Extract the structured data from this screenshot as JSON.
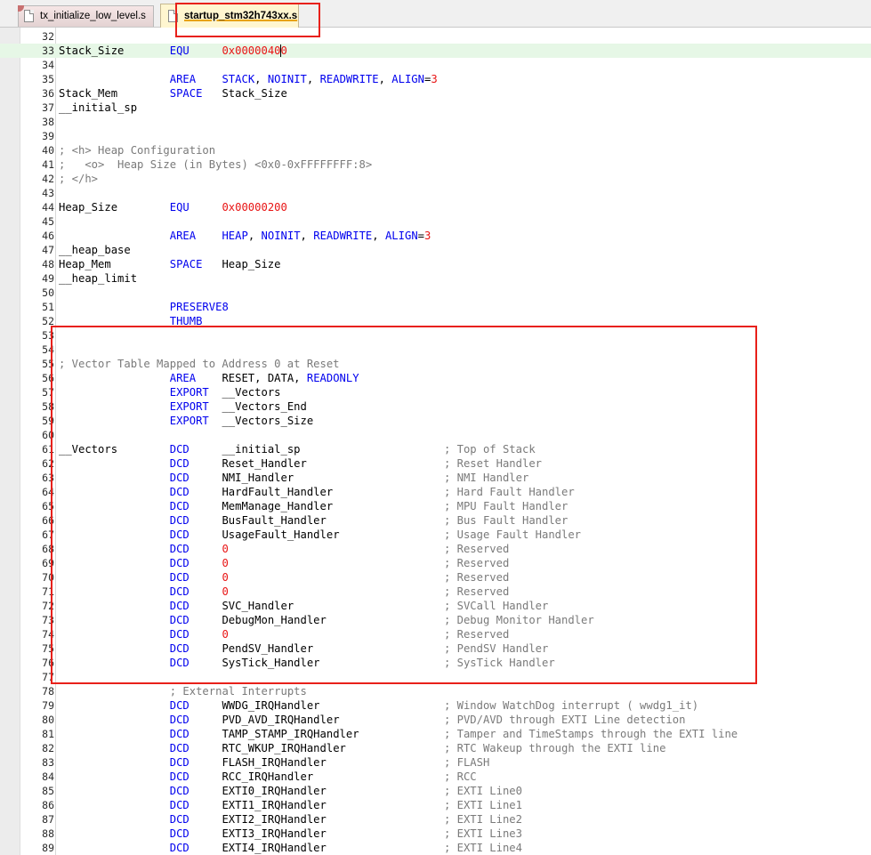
{
  "tabs": [
    {
      "label": "tx_initialize_low_level.s",
      "active": false
    },
    {
      "label": "startup_stm32h743xx.s",
      "active": true
    }
  ],
  "colors": {
    "keyword": "#0000ee",
    "number": "#e81414",
    "comment": "#7a7a7a",
    "current_line": "#e6f7e6",
    "annotation_box": "#e8201a"
  },
  "editor": {
    "current_line": 33,
    "lines": [
      {
        "n": "32",
        "t": []
      },
      {
        "n": "33",
        "t": [
          [
            "",
            "Stack_Size       "
          ],
          [
            "kw",
            "EQU"
          ],
          [
            "",
            "     "
          ],
          [
            "num",
            "0x00000400"
          ]
        ]
      },
      {
        "n": "34",
        "t": []
      },
      {
        "n": "35",
        "t": [
          [
            "",
            "                 "
          ],
          [
            "kw",
            "AREA"
          ],
          [
            "",
            "    "
          ],
          [
            "kw",
            "STACK"
          ],
          [
            "",
            ", "
          ],
          [
            "kw",
            "NOINIT"
          ],
          [
            "",
            ", "
          ],
          [
            "kw",
            "READWRITE"
          ],
          [
            "",
            ", "
          ],
          [
            "kw",
            "ALIGN"
          ],
          [
            "",
            "="
          ],
          [
            "num",
            "3"
          ]
        ]
      },
      {
        "n": "36",
        "t": [
          [
            "",
            "Stack_Mem        "
          ],
          [
            "kw",
            "SPACE"
          ],
          [
            "",
            "   Stack_Size"
          ]
        ]
      },
      {
        "n": "37",
        "t": [
          [
            "",
            "__initial_sp"
          ]
        ]
      },
      {
        "n": "38",
        "t": []
      },
      {
        "n": "39",
        "t": []
      },
      {
        "n": "40",
        "t": [
          [
            "cm",
            "; <h> Heap Configuration"
          ]
        ]
      },
      {
        "n": "41",
        "t": [
          [
            "cm",
            ";   <o>  Heap Size (in Bytes) <0x0-0xFFFFFFFF:8>"
          ]
        ]
      },
      {
        "n": "42",
        "t": [
          [
            "cm",
            "; </h>"
          ]
        ]
      },
      {
        "n": "43",
        "t": []
      },
      {
        "n": "44",
        "t": [
          [
            "",
            "Heap_Size        "
          ],
          [
            "kw",
            "EQU"
          ],
          [
            "",
            "     "
          ],
          [
            "num",
            "0x00000200"
          ]
        ]
      },
      {
        "n": "45",
        "t": []
      },
      {
        "n": "46",
        "t": [
          [
            "",
            "                 "
          ],
          [
            "kw",
            "AREA"
          ],
          [
            "",
            "    "
          ],
          [
            "kw",
            "HEAP"
          ],
          [
            "",
            ", "
          ],
          [
            "kw",
            "NOINIT"
          ],
          [
            "",
            ", "
          ],
          [
            "kw",
            "READWRITE"
          ],
          [
            "",
            ", "
          ],
          [
            "kw",
            "ALIGN"
          ],
          [
            "",
            "="
          ],
          [
            "num",
            "3"
          ]
        ]
      },
      {
        "n": "47",
        "t": [
          [
            "",
            "__heap_base"
          ]
        ]
      },
      {
        "n": "48",
        "t": [
          [
            "",
            "Heap_Mem         "
          ],
          [
            "kw",
            "SPACE"
          ],
          [
            "",
            "   Heap_Size"
          ]
        ]
      },
      {
        "n": "49",
        "t": [
          [
            "",
            "__heap_limit"
          ]
        ]
      },
      {
        "n": "50",
        "t": []
      },
      {
        "n": "51",
        "t": [
          [
            "",
            "                 "
          ],
          [
            "kw",
            "PRESERVE8"
          ]
        ]
      },
      {
        "n": "52",
        "t": [
          [
            "",
            "                 "
          ],
          [
            "kw",
            "THUMB"
          ]
        ]
      },
      {
        "n": "53",
        "t": []
      },
      {
        "n": "54",
        "t": []
      },
      {
        "n": "55",
        "t": [
          [
            "cm",
            "; Vector Table Mapped to Address 0 at Reset"
          ]
        ]
      },
      {
        "n": "56",
        "t": [
          [
            "",
            "                 "
          ],
          [
            "kw",
            "AREA"
          ],
          [
            "",
            "    RESET, DATA, "
          ],
          [
            "kw",
            "READONLY"
          ]
        ]
      },
      {
        "n": "57",
        "t": [
          [
            "",
            "                 "
          ],
          [
            "kw",
            "EXPORT"
          ],
          [
            "",
            "  __Vectors"
          ]
        ]
      },
      {
        "n": "58",
        "t": [
          [
            "",
            "                 "
          ],
          [
            "kw",
            "EXPORT"
          ],
          [
            "",
            "  __Vectors_End"
          ]
        ]
      },
      {
        "n": "59",
        "t": [
          [
            "",
            "                 "
          ],
          [
            "kw",
            "EXPORT"
          ],
          [
            "",
            "  __Vectors_Size"
          ]
        ]
      },
      {
        "n": "60",
        "t": []
      },
      {
        "n": "61",
        "t": [
          [
            "",
            "__Vectors        "
          ],
          [
            "kw",
            "DCD"
          ],
          [
            "",
            "     __initial_sp                      "
          ],
          [
            "cm",
            "; Top of Stack"
          ]
        ]
      },
      {
        "n": "62",
        "t": [
          [
            "",
            "                 "
          ],
          [
            "kw",
            "DCD"
          ],
          [
            "",
            "     Reset_Handler                     "
          ],
          [
            "cm",
            "; Reset Handler"
          ]
        ]
      },
      {
        "n": "63",
        "t": [
          [
            "",
            "                 "
          ],
          [
            "kw",
            "DCD"
          ],
          [
            "",
            "     NMI_Handler                       "
          ],
          [
            "cm",
            "; NMI Handler"
          ]
        ]
      },
      {
        "n": "64",
        "t": [
          [
            "",
            "                 "
          ],
          [
            "kw",
            "DCD"
          ],
          [
            "",
            "     HardFault_Handler                 "
          ],
          [
            "cm",
            "; Hard Fault Handler"
          ]
        ]
      },
      {
        "n": "65",
        "t": [
          [
            "",
            "                 "
          ],
          [
            "kw",
            "DCD"
          ],
          [
            "",
            "     MemManage_Handler                 "
          ],
          [
            "cm",
            "; MPU Fault Handler"
          ]
        ]
      },
      {
        "n": "66",
        "t": [
          [
            "",
            "                 "
          ],
          [
            "kw",
            "DCD"
          ],
          [
            "",
            "     BusFault_Handler                  "
          ],
          [
            "cm",
            "; Bus Fault Handler"
          ]
        ]
      },
      {
        "n": "67",
        "t": [
          [
            "",
            "                 "
          ],
          [
            "kw",
            "DCD"
          ],
          [
            "",
            "     UsageFault_Handler                "
          ],
          [
            "cm",
            "; Usage Fault Handler"
          ]
        ]
      },
      {
        "n": "68",
        "t": [
          [
            "",
            "                 "
          ],
          [
            "kw",
            "DCD"
          ],
          [
            "",
            "     "
          ],
          [
            "num",
            "0"
          ],
          [
            "",
            "                                 "
          ],
          [
            "cm",
            "; Reserved"
          ]
        ]
      },
      {
        "n": "69",
        "t": [
          [
            "",
            "                 "
          ],
          [
            "kw",
            "DCD"
          ],
          [
            "",
            "     "
          ],
          [
            "num",
            "0"
          ],
          [
            "",
            "                                 "
          ],
          [
            "cm",
            "; Reserved"
          ]
        ]
      },
      {
        "n": "70",
        "t": [
          [
            "",
            "                 "
          ],
          [
            "kw",
            "DCD"
          ],
          [
            "",
            "     "
          ],
          [
            "num",
            "0"
          ],
          [
            "",
            "                                 "
          ],
          [
            "cm",
            "; Reserved"
          ]
        ]
      },
      {
        "n": "71",
        "t": [
          [
            "",
            "                 "
          ],
          [
            "kw",
            "DCD"
          ],
          [
            "",
            "     "
          ],
          [
            "num",
            "0"
          ],
          [
            "",
            "                                 "
          ],
          [
            "cm",
            "; Reserved"
          ]
        ]
      },
      {
        "n": "72",
        "t": [
          [
            "",
            "                 "
          ],
          [
            "kw",
            "DCD"
          ],
          [
            "",
            "     SVC_Handler                       "
          ],
          [
            "cm",
            "; SVCall Handler"
          ]
        ]
      },
      {
        "n": "73",
        "t": [
          [
            "",
            "                 "
          ],
          [
            "kw",
            "DCD"
          ],
          [
            "",
            "     DebugMon_Handler                  "
          ],
          [
            "cm",
            "; Debug Monitor Handler"
          ]
        ]
      },
      {
        "n": "74",
        "t": [
          [
            "",
            "                 "
          ],
          [
            "kw",
            "DCD"
          ],
          [
            "",
            "     "
          ],
          [
            "num",
            "0"
          ],
          [
            "",
            "                                 "
          ],
          [
            "cm",
            "; Reserved"
          ]
        ]
      },
      {
        "n": "75",
        "t": [
          [
            "",
            "                 "
          ],
          [
            "kw",
            "DCD"
          ],
          [
            "",
            "     PendSV_Handler                    "
          ],
          [
            "cm",
            "; PendSV Handler"
          ]
        ]
      },
      {
        "n": "76",
        "t": [
          [
            "",
            "                 "
          ],
          [
            "kw",
            "DCD"
          ],
          [
            "",
            "     SysTick_Handler                   "
          ],
          [
            "cm",
            "; SysTick Handler"
          ]
        ]
      },
      {
        "n": "77",
        "t": []
      },
      {
        "n": "78",
        "t": [
          [
            "",
            "                 "
          ],
          [
            "cm",
            "; External Interrupts"
          ]
        ]
      },
      {
        "n": "79",
        "t": [
          [
            "",
            "                 "
          ],
          [
            "kw",
            "DCD"
          ],
          [
            "",
            "     WWDG_IRQHandler                   "
          ],
          [
            "cm",
            "; Window WatchDog interrupt ( wwdg1_it)"
          ]
        ]
      },
      {
        "n": "80",
        "t": [
          [
            "",
            "                 "
          ],
          [
            "kw",
            "DCD"
          ],
          [
            "",
            "     PVD_AVD_IRQHandler                "
          ],
          [
            "cm",
            "; PVD/AVD through EXTI Line detection"
          ]
        ]
      },
      {
        "n": "81",
        "t": [
          [
            "",
            "                 "
          ],
          [
            "kw",
            "DCD"
          ],
          [
            "",
            "     TAMP_STAMP_IRQHandler             "
          ],
          [
            "cm",
            "; Tamper and TimeStamps through the EXTI line"
          ]
        ]
      },
      {
        "n": "82",
        "t": [
          [
            "",
            "                 "
          ],
          [
            "kw",
            "DCD"
          ],
          [
            "",
            "     RTC_WKUP_IRQHandler               "
          ],
          [
            "cm",
            "; RTC Wakeup through the EXTI line"
          ]
        ]
      },
      {
        "n": "83",
        "t": [
          [
            "",
            "                 "
          ],
          [
            "kw",
            "DCD"
          ],
          [
            "",
            "     FLASH_IRQHandler                  "
          ],
          [
            "cm",
            "; FLASH"
          ]
        ]
      },
      {
        "n": "84",
        "t": [
          [
            "",
            "                 "
          ],
          [
            "kw",
            "DCD"
          ],
          [
            "",
            "     RCC_IRQHandler                    "
          ],
          [
            "cm",
            "; RCC"
          ]
        ]
      },
      {
        "n": "85",
        "t": [
          [
            "",
            "                 "
          ],
          [
            "kw",
            "DCD"
          ],
          [
            "",
            "     EXTI0_IRQHandler                  "
          ],
          [
            "cm",
            "; EXTI Line0"
          ]
        ]
      },
      {
        "n": "86",
        "t": [
          [
            "",
            "                 "
          ],
          [
            "kw",
            "DCD"
          ],
          [
            "",
            "     EXTI1_IRQHandler                  "
          ],
          [
            "cm",
            "; EXTI Line1"
          ]
        ]
      },
      {
        "n": "87",
        "t": [
          [
            "",
            "                 "
          ],
          [
            "kw",
            "DCD"
          ],
          [
            "",
            "     EXTI2_IRQHandler                  "
          ],
          [
            "cm",
            "; EXTI Line2"
          ]
        ]
      },
      {
        "n": "88",
        "t": [
          [
            "",
            "                 "
          ],
          [
            "kw",
            "DCD"
          ],
          [
            "",
            "     EXTI3_IRQHandler                  "
          ],
          [
            "cm",
            "; EXTI Line3"
          ]
        ]
      },
      {
        "n": "89",
        "t": [
          [
            "",
            "                 "
          ],
          [
            "kw",
            "DCD"
          ],
          [
            "",
            "     EXTI4_IRQHandler                  "
          ],
          [
            "cm",
            "; EXTI Line4"
          ]
        ]
      }
    ]
  }
}
